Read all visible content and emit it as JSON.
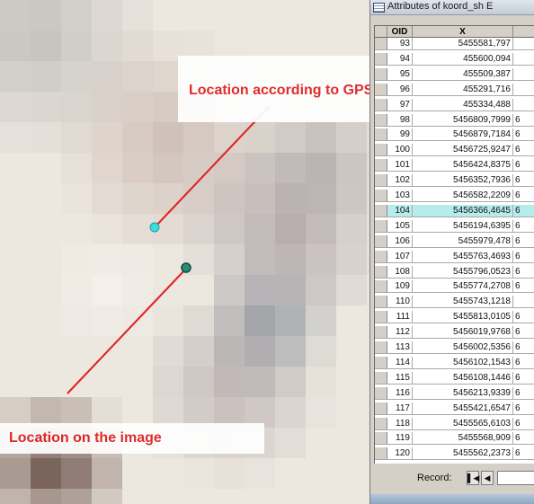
{
  "annotations": {
    "gps_label": "Location according to   GPS",
    "image_label": "Location on the image"
  },
  "attribute_table": {
    "title": "Attributes of koord_sh E",
    "columns": [
      "OID",
      "X",
      ""
    ],
    "rows": [
      {
        "oid": "93",
        "x": "5455581,797",
        "y": ""
      },
      {
        "oid": "94",
        "x": "455600,094",
        "y": ""
      },
      {
        "oid": "95",
        "x": "455509,387",
        "y": ""
      },
      {
        "oid": "96",
        "x": "455291,716",
        "y": ""
      },
      {
        "oid": "97",
        "x": "455334,488",
        "y": ""
      },
      {
        "oid": "98",
        "x": "5456809,7999",
        "y": "6"
      },
      {
        "oid": "99",
        "x": "5456879,7184",
        "y": "6"
      },
      {
        "oid": "100",
        "x": "5456725,9247",
        "y": "6"
      },
      {
        "oid": "101",
        "x": "5456424,8375",
        "y": "6"
      },
      {
        "oid": "102",
        "x": "5456352,7936",
        "y": "6"
      },
      {
        "oid": "103",
        "x": "5456582,2209",
        "y": "6"
      },
      {
        "oid": "104",
        "x": "5456366,4645",
        "y": "6"
      },
      {
        "oid": "105",
        "x": "5456194,6395",
        "y": "6"
      },
      {
        "oid": "106",
        "x": "5455979,478",
        "y": "6"
      },
      {
        "oid": "107",
        "x": "5455763,4693",
        "y": "6"
      },
      {
        "oid": "108",
        "x": "5455796,0523",
        "y": "6"
      },
      {
        "oid": "109",
        "x": "5455774,2708",
        "y": "6"
      },
      {
        "oid": "110",
        "x": "5455743,1218",
        "y": ""
      },
      {
        "oid": "111",
        "x": "5455813,0105",
        "y": "6"
      },
      {
        "oid": "112",
        "x": "5456019,9768",
        "y": "6"
      },
      {
        "oid": "113",
        "x": "5456002,5356",
        "y": "6"
      },
      {
        "oid": "114",
        "x": "5456102,1543",
        "y": "6"
      },
      {
        "oid": "115",
        "x": "5456108,1446",
        "y": "6"
      },
      {
        "oid": "116",
        "x": "5456213,9339",
        "y": "6"
      },
      {
        "oid": "117",
        "x": "5455421,6547",
        "y": "6"
      },
      {
        "oid": "118",
        "x": "5455565,6103",
        "y": "6"
      },
      {
        "oid": "119",
        "x": "5455568,909",
        "y": "6"
      },
      {
        "oid": "120",
        "x": "5455562,2373",
        "y": "6"
      }
    ],
    "selected_oid": "104",
    "record_label": "Record:",
    "nav_first_icon": "first-record-icon",
    "nav_prev_icon": "previous-record-icon"
  },
  "colors": {
    "annotation_red": "#e02020",
    "gps_point": "#3cdcdc",
    "image_point": "#2f8a78",
    "selected_row": "#b7ecec"
  }
}
